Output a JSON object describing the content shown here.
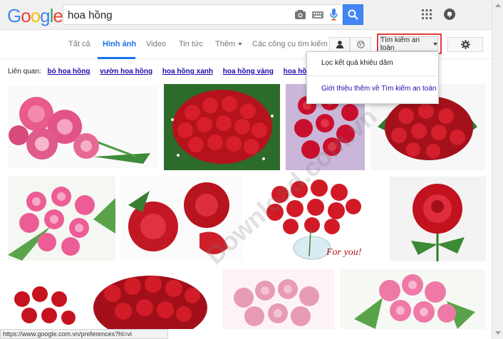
{
  "header": {
    "logo_letters": [
      {
        "ch": "G",
        "color": "#4285f4"
      },
      {
        "ch": "o",
        "color": "#ea4335"
      },
      {
        "ch": "o",
        "color": "#fbbc05"
      },
      {
        "ch": "g",
        "color": "#4285f4"
      },
      {
        "ch": "l",
        "color": "#34a853"
      },
      {
        "ch": "e",
        "color": "#ea4335"
      }
    ],
    "search_value": "hoa hồng",
    "icons": [
      "camera-icon",
      "keyboard-icon",
      "microphone-icon",
      "search-icon",
      "apps-grid-icon",
      "notifications-icon"
    ]
  },
  "nav": {
    "tabs": [
      "Tất cả",
      "Hình ảnh",
      "Video",
      "Tin tức",
      "Thêm",
      "Các công cụ tìm kiếm"
    ],
    "active_tab": "Hình ảnh",
    "safe_search_label": "Tìm kiếm an toàn",
    "accent": "#1a73e8",
    "highlight_color": "#e53935"
  },
  "related": {
    "label": "Liên quan:",
    "links": [
      "bó hoa hồng",
      "vườn hoa hồng",
      "hoa hồng xanh",
      "hoa hồng vàng",
      "hoa hồng tím"
    ]
  },
  "dropdown": {
    "item1": "Lọc kết quả khiêu dâm",
    "item2": "Giới thiệu thêm về Tìm kiếm an toàn"
  },
  "images": {
    "caption": "For you!",
    "watermark": "Download.com.vn"
  },
  "status_bar": {
    "url": "https://www.google.com.vn/preferences?hl=vi"
  }
}
